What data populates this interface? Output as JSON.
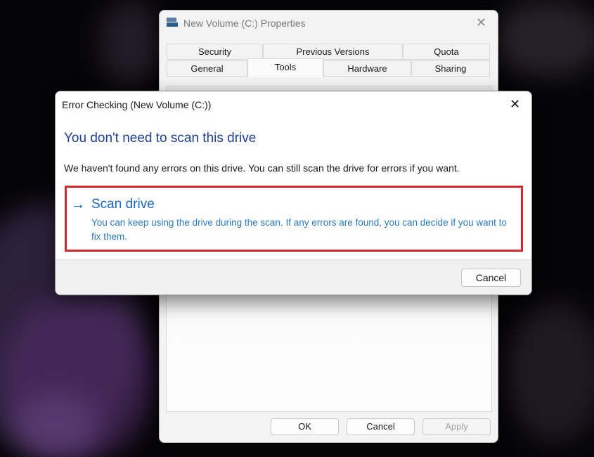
{
  "properties_window": {
    "title": "New Volume (C:) Properties",
    "close_glyph": "✕",
    "tabs_top": [
      "Security",
      "Previous Versions",
      "Quota"
    ],
    "tabs_bottom": [
      "General",
      "Tools",
      "Hardware",
      "Sharing"
    ],
    "active_tab": "Tools",
    "buttons": {
      "ok": "OK",
      "cancel": "Cancel",
      "apply": "Apply"
    },
    "apply_disabled": true
  },
  "dialog": {
    "title": "Error Checking (New Volume (C:))",
    "close_glyph": "✕",
    "heading": "You don't need to scan this drive",
    "message": "We haven't found any errors on this drive. You can still scan the drive for errors if you want.",
    "scan_option": {
      "arrow_glyph": "→",
      "title": "Scan drive",
      "description": "You can keep using the drive during the scan. If any errors are found, you can decide if you want to fix them."
    },
    "cancel_label": "Cancel"
  },
  "colors": {
    "heading_blue": "#1f3f8f",
    "link_blue": "#1a66c4",
    "highlight_red": "#d7262e"
  },
  "icons": {
    "properties_window_icon": "drive-icon",
    "scan_arrow": "arrow-right-icon"
  }
}
